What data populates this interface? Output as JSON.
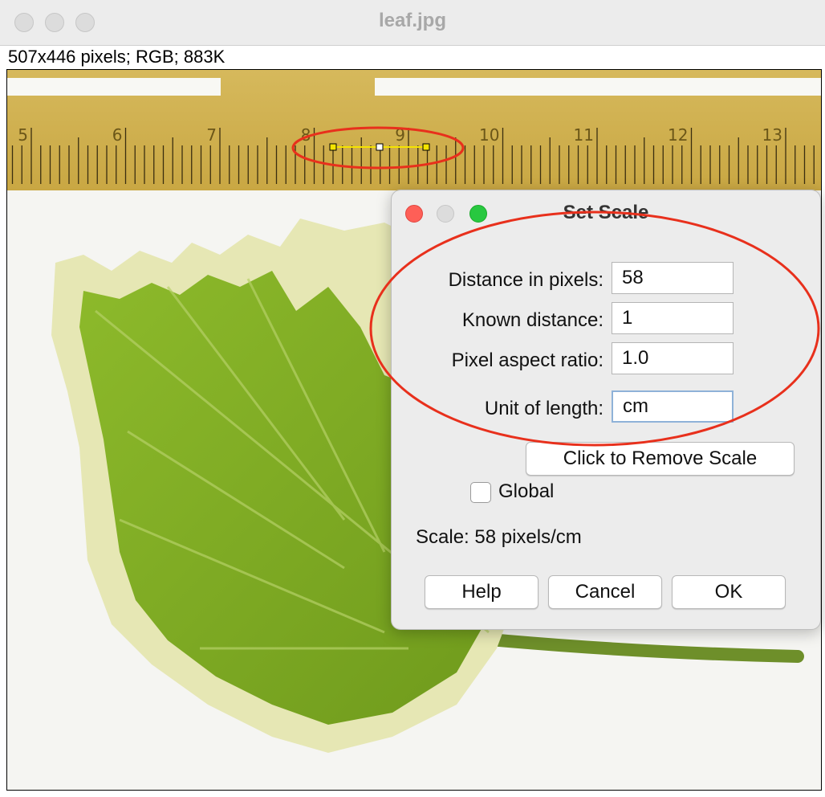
{
  "window": {
    "title": "leaf.jpg",
    "info": "507x446 pixels; RGB; 883K"
  },
  "ruler": {
    "labels": [
      "5",
      "6",
      "7",
      "8",
      "9",
      "10",
      "11",
      "12",
      "13"
    ]
  },
  "dialog": {
    "title": "Set Scale",
    "fields": [
      {
        "label": "Distance in pixels:",
        "value": "58"
      },
      {
        "label": "Known distance:",
        "value": "1"
      },
      {
        "label": "Pixel aspect ratio:",
        "value": "1.0"
      },
      {
        "label": "Unit of length:",
        "value": "cm"
      }
    ],
    "remove_scale_label": "Click to Remove Scale",
    "global_label": "Global",
    "global_checked": false,
    "scale_text": "Scale: 58 pixels/cm",
    "buttons": {
      "help": "Help",
      "cancel": "Cancel",
      "ok": "OK"
    }
  },
  "colors": {
    "annotation": "#e8301c",
    "selection_line": "#f5e400",
    "close": "#fe5f57",
    "zoom": "#28c840"
  }
}
